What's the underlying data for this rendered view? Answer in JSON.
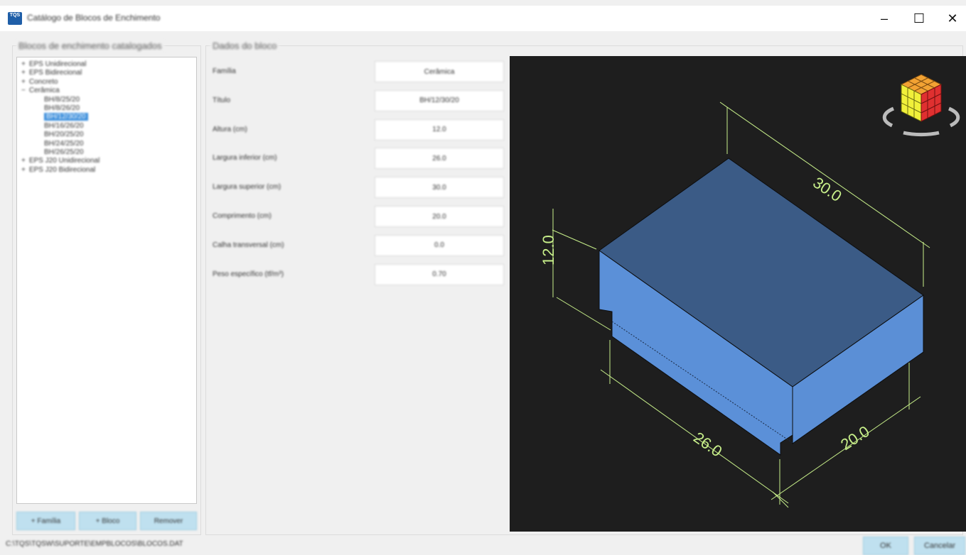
{
  "window": {
    "title": "Catálogo de Blocos de Enchimento",
    "app_icon_text": "TQS",
    "minimize_glyph": "–",
    "maximize_glyph": "☐",
    "close_glyph": "✕"
  },
  "left_panel": {
    "title": "Blocos de enchimento catalogados",
    "tree": [
      {
        "label": "EPS Unidirecional",
        "expander": "+",
        "level": 0
      },
      {
        "label": "EPS Bidirecional",
        "expander": "+",
        "level": 0
      },
      {
        "label": "Concreto",
        "expander": "+",
        "level": 0
      },
      {
        "label": "Cerâmica",
        "expander": "−",
        "level": 0
      },
      {
        "label": "BH/8/25/20",
        "expander": "",
        "level": 1
      },
      {
        "label": "BH/8/26/20",
        "expander": "",
        "level": 1
      },
      {
        "label": "BH/12/30/20",
        "expander": "",
        "level": 1,
        "selected": true
      },
      {
        "label": "BH/16/26/20",
        "expander": "",
        "level": 1
      },
      {
        "label": "BH/20/25/20",
        "expander": "",
        "level": 1
      },
      {
        "label": "BH/24/25/20",
        "expander": "",
        "level": 1
      },
      {
        "label": "BH/26/25/20",
        "expander": "",
        "level": 1
      },
      {
        "label": "EPS J20 Unidirecional",
        "expander": "+",
        "level": 0
      },
      {
        "label": "EPS J20 Bidirecional",
        "expander": "+",
        "level": 0
      }
    ],
    "buttons": {
      "new_family": "+ Família",
      "new_block": "+ Bloco",
      "remove": "Remover"
    }
  },
  "block_data": {
    "title": "Dados do bloco",
    "fields": [
      {
        "label": "Família",
        "value": "Cerâmica"
      },
      {
        "label": "Título",
        "value": "BH/12/30/20"
      },
      {
        "label": "Altura (cm)",
        "value": "12.0"
      },
      {
        "label": "Largura inferior (cm)",
        "value": "26.0"
      },
      {
        "label": "Largura superior (cm)",
        "value": "30.0"
      },
      {
        "label": "Comprimento (cm)",
        "value": "20.0"
      },
      {
        "label": "Calha transversal (cm)",
        "value": "0.0"
      },
      {
        "label": "Peso específico (tf/m³)",
        "value": "0.70"
      }
    ]
  },
  "viewport": {
    "dimensions": {
      "top_width": "30.0",
      "height": "12.0",
      "bottom_width": "26.0",
      "length": "20.0"
    },
    "colors": {
      "background": "#1e1e1e",
      "top_face": "#3b5b86",
      "side_face": "#5b90d8",
      "dimension_lines": "#c8f08a"
    },
    "nav_cube_icon": "rubiks-cube-icon"
  },
  "status_bar": {
    "text": "C:\\TQS\\TQSW\\SUPORTE\\EMPBLOCOS\\BLOCOS.DAT"
  },
  "dialog_buttons": {
    "ok": "OK",
    "cancel": "Cancelar"
  }
}
